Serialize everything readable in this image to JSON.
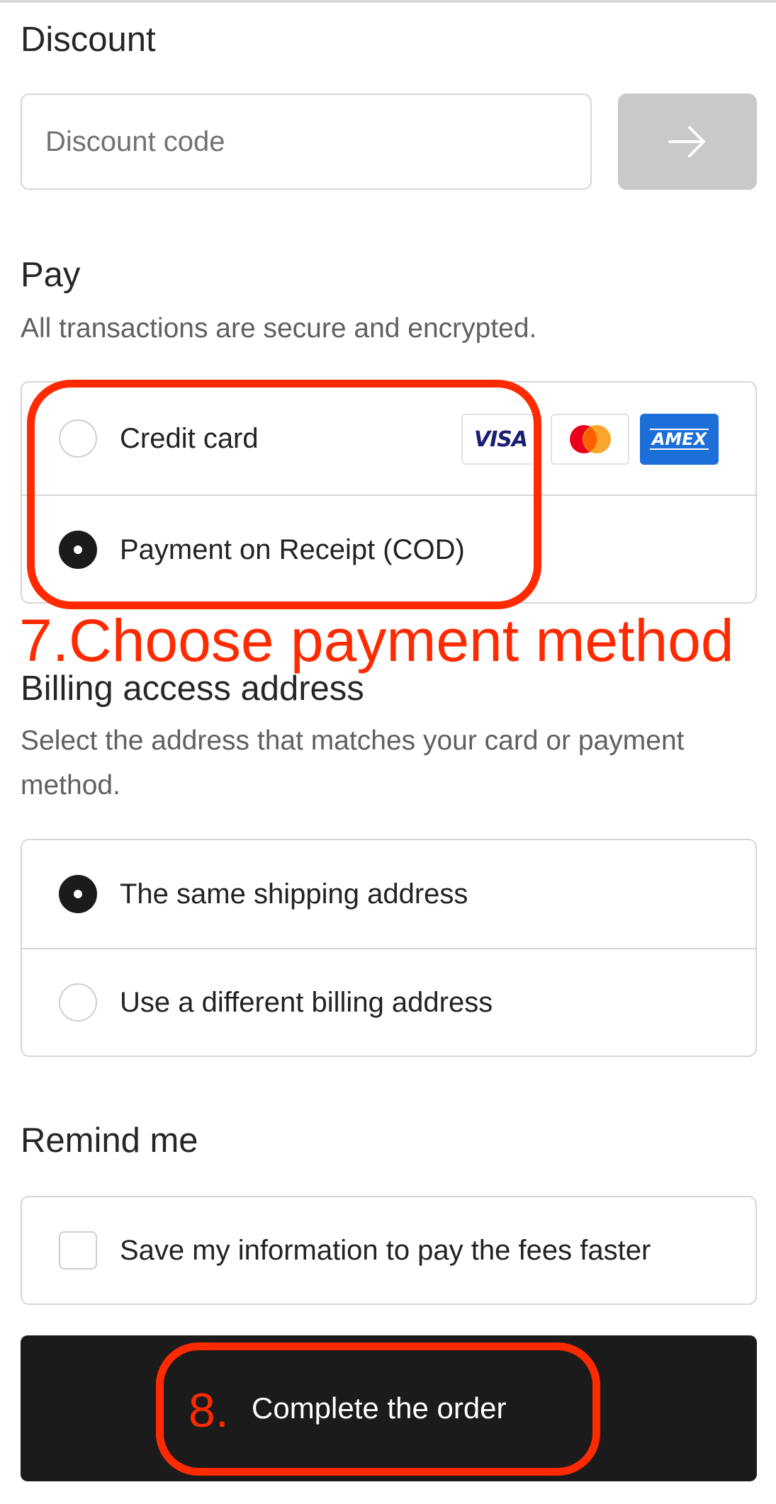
{
  "discount": {
    "heading": "Discount",
    "placeholder": "Discount code"
  },
  "pay": {
    "heading": "Pay",
    "subtitle": "All transactions are secure and encrypted.",
    "options": [
      {
        "label": "Credit card",
        "selected": false
      },
      {
        "label": "Payment on Receipt (COD)",
        "selected": true
      }
    ],
    "card_logos": [
      "VISA",
      "mastercard",
      "AMEX"
    ]
  },
  "annotations": {
    "step7": "7.Choose payment method",
    "step8": "8."
  },
  "billing": {
    "heading": "Billing access address",
    "subtitle": "Select the address that matches your card or payment method.",
    "options": [
      {
        "label": "The same shipping address",
        "selected": true
      },
      {
        "label": "Use a different billing address",
        "selected": false
      }
    ]
  },
  "remind": {
    "heading": "Remind me",
    "checkbox_label": "Save my information to pay the fees faster",
    "checked": false
  },
  "submit": {
    "label": "Complete the order"
  },
  "colors": {
    "annotation": "#ff2a00",
    "primary_button": "#1b1b1b",
    "apply_button": "#c9c9c9",
    "amex_blue": "#1c6fd8"
  }
}
